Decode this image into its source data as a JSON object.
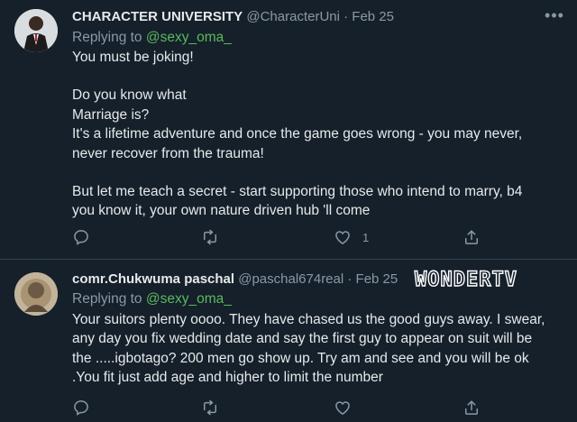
{
  "tweets": [
    {
      "display_name": "CHARACTER UNIVERSITY",
      "handle": "@CharacterUni",
      "separator": "·",
      "date": "Feb 25",
      "replying_prefix": "Replying to",
      "replying_to": "@sexy_oma_",
      "paragraphs": [
        [
          "You must be joking!"
        ],
        [
          "Do you know what",
          "Marriage is?",
          "It's a lifetime adventure and once the game goes wrong - you may never,",
          "never recover from the trauma!"
        ],
        [
          "But let me teach a secret - start supporting those who intend to marry, b4",
          "you know it, your own nature driven hub 'll come"
        ]
      ],
      "like_count": "1"
    },
    {
      "display_name": "comr.Chukwuma paschal",
      "handle": "@paschal674real",
      "separator": "·",
      "date": "Feb 25",
      "replying_prefix": "Replying to",
      "replying_to": "@sexy_oma_",
      "paragraphs": [
        [
          "Your suitors plenty oooo. They have chased us the good guys away. I swear,",
          "any day you fix wedding date and say the first guy to appear on suit will be",
          "the .....igbotago?  200 men go show up. Try am and see and you will be ok",
          ".You fit just add age and higher to limit the number"
        ]
      ],
      "like_count": ""
    }
  ],
  "watermark": "WONDERTV",
  "icons": {
    "reply": "reply-icon",
    "retweet": "retweet-icon",
    "like": "heart-icon",
    "share": "share-icon",
    "more": "more-options-icon"
  },
  "colors": {
    "background": "#15202b",
    "mention": "#5cb85c",
    "muted": "#8b98a5"
  }
}
